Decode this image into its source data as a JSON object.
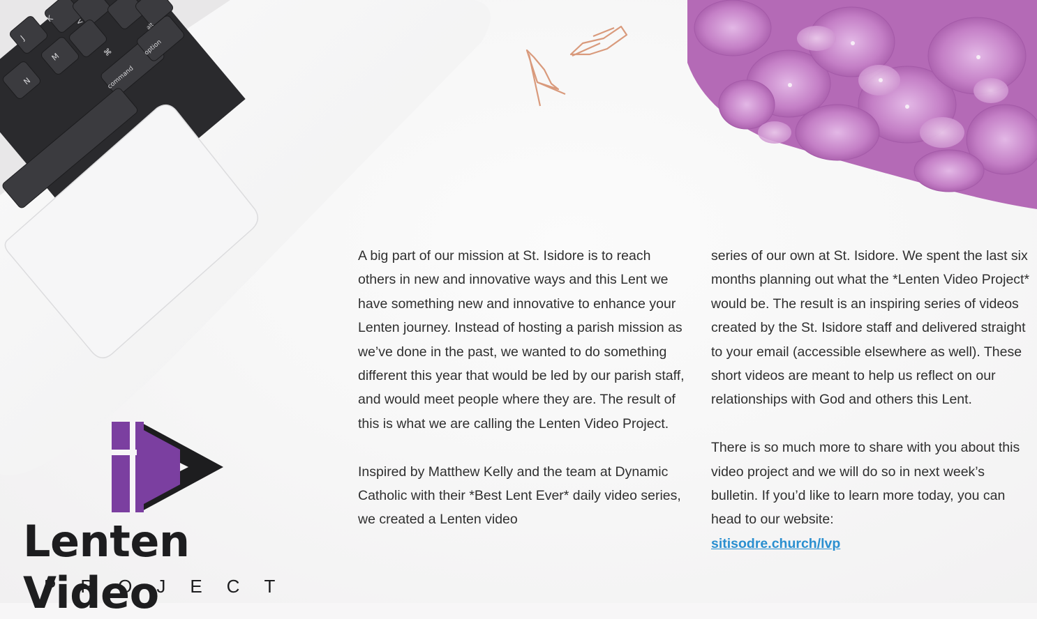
{
  "decor": {
    "laptop_keys": [
      "J",
      "K",
      "<",
      "N",
      "M",
      "⌘",
      "command",
      "option",
      "alt"
    ]
  },
  "logo": {
    "title": "Lenten Video",
    "subtitle": "PROJECT",
    "accent_color": "#7b3fa0",
    "mark_color": "#1d1d1f"
  },
  "article": {
    "column1": [
      "A big part of our mission at St. Isidore is to reach others in new and innovative ways and this Lent we have something new and innovative to enhance your Lenten journey. Instead of hosting a parish mission as we’ve done in the past, we wanted to do something different this year that would be led by our parish staff, and would meet people where they are.  The result of this is what we are calling the Lenten Video Project.",
      "Inspired by Matthew Kelly and the team at Dynamic Catholic with their *Best Lent Ever* daily video series, we created a Lenten video"
    ],
    "column2": [
      "series of our own at St. Isidore. We spent the last six months planning out what the *Lenten Video Project* would be. The result is an inspiring series of videos created by the St. Isidore staff and delivered straight to your email (accessible elsewhere as well). These short videos are meant to help us reflect on our relationships with God and others this Lent.",
      "There is so much more to share with you about this video project and we will do so in next week’s bulletin. If you’d like to learn more today, you can head to our website:"
    ],
    "link": "sitisodre.church/lvp",
    "link_color": "#2a8fd0"
  }
}
